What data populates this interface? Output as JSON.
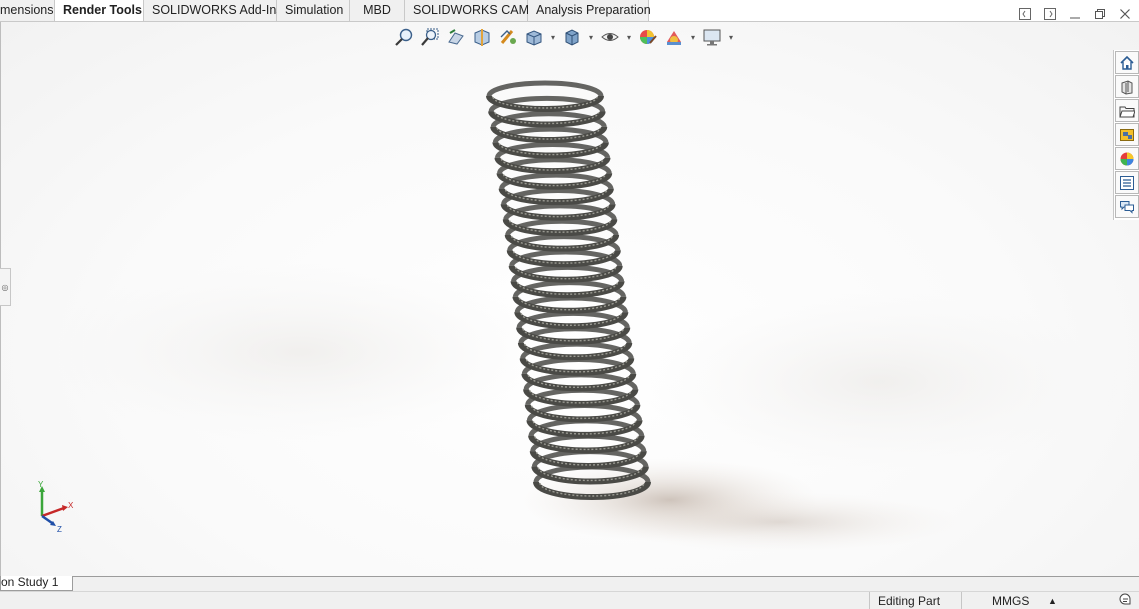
{
  "ribbon": {
    "tabs": [
      {
        "label": "mensions",
        "active": false
      },
      {
        "label": "Render Tools",
        "active": true
      },
      {
        "label": "SOLIDWORKS Add-Ins",
        "active": false
      },
      {
        "label": "Simulation",
        "active": false
      },
      {
        "label": "MBD",
        "active": false
      },
      {
        "label": "SOLIDWORKS CAM",
        "active": false
      },
      {
        "label": "Analysis Preparation",
        "active": false
      }
    ]
  },
  "window_controls": [
    "dock-left-icon",
    "dock-right-icon",
    "minimize-icon",
    "restore-icon",
    "close-icon"
  ],
  "heads_up_toolbar": [
    "zoom-to-fit-icon",
    "zoom-to-area-icon",
    "previous-view-icon",
    "section-view-icon",
    "dynamic-annotation-icon",
    "view-orientation-icon",
    "display-style-icon",
    "hide-show-items-icon",
    "edit-appearance-icon",
    "apply-scene-icon",
    "view-settings-icon"
  ],
  "task_pane": [
    "home-icon",
    "design-library-icon",
    "file-explorer-icon",
    "view-palette-icon",
    "appearances-icon",
    "custom-properties-icon",
    "forum-icon"
  ],
  "triad": {
    "x_label": "X",
    "y_label": "Y",
    "z_label": "Z"
  },
  "study_tabs": {
    "active_label": "on Study 1"
  },
  "status_bar": {
    "mode": "Editing Part",
    "units": "MMGS",
    "units_caret": "▲"
  },
  "colors": {
    "spring": "#4a4a46",
    "spring_highlight": "#9a9a92",
    "accent_blue": "#1f5fa8"
  }
}
